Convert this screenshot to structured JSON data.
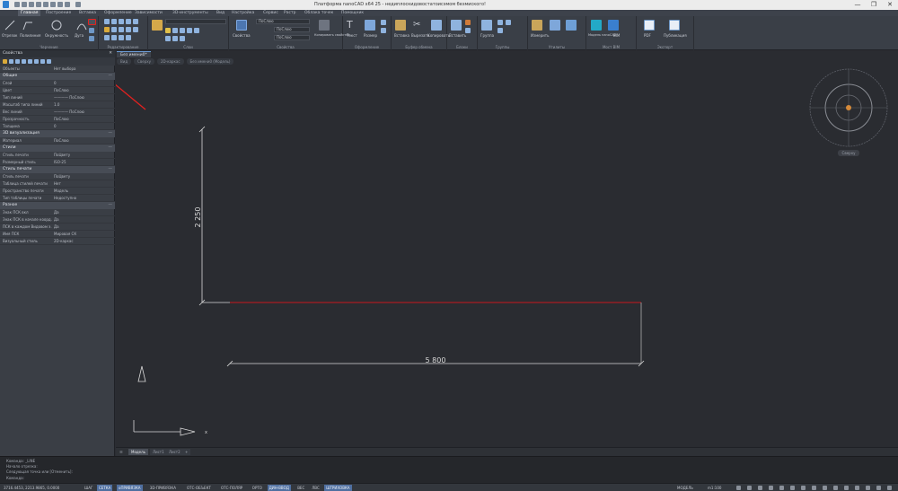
{
  "window": {
    "title": "Платформа nanoCAD x64 25 - недиплоскидовостатоисэмом безмиского!",
    "controls": [
      "—",
      "❐",
      "✕"
    ]
  },
  "menu_tabs": [
    {
      "label": "Главная",
      "active": true
    },
    {
      "label": "Построение",
      "active": false
    },
    {
      "label": "Вставка",
      "active": false
    },
    {
      "label": "Оформление",
      "active": false
    },
    {
      "label": "Зависимости",
      "active": false
    },
    {
      "label": "3D-инструменты",
      "active": false
    },
    {
      "label": "Вид",
      "active": false
    },
    {
      "label": "Настройка",
      "active": false
    },
    {
      "label": "Сервис",
      "active": false
    },
    {
      "label": "Растр",
      "active": false
    },
    {
      "label": "Облака точек",
      "active": false
    },
    {
      "label": "Помощник",
      "active": false
    }
  ],
  "ribbon": {
    "groups": [
      {
        "label": "Черчение"
      },
      {
        "label": "Редактирование"
      },
      {
        "label": "Слои"
      },
      {
        "label": "Свойства"
      },
      {
        "label": "Оформление"
      },
      {
        "label": "Буфер обмена"
      },
      {
        "label": "Блоки"
      },
      {
        "label": "Группы"
      },
      {
        "label": "Утилиты"
      },
      {
        "label": "Мост BIM"
      },
      {
        "label": "Экспорт"
      }
    ],
    "draw_tools": [
      "Отрезок",
      "Полилиния",
      "Окружность",
      "Дуга"
    ],
    "props_dropdowns": [
      "ПоСлою",
      "ПоСлою",
      "ПоСлою"
    ],
    "props_tools": [
      "Свойства",
      "Копировать свойства"
    ],
    "annot_tools": [
      "Текст",
      "Размер"
    ],
    "clipboard_tools": [
      "Вставка",
      "Вырезать",
      "Копировать"
    ],
    "block_tools": [
      "Вставить",
      "Создать блок"
    ],
    "group_tools": [
      "Группа"
    ],
    "util_tools": [
      "Измерить"
    ],
    "bim_tools": [
      "Модель nanoCAD",
      "BIM"
    ],
    "export_tools": [
      "PDF",
      "Публикация"
    ]
  },
  "properties": {
    "title": "Свойства",
    "selection": "Нет выбора",
    "objects_label": "Объекты",
    "sections": [
      {
        "name": "Общие",
        "rows": [
          {
            "k": "Слой",
            "v": "0"
          },
          {
            "k": "Цвет",
            "v": "ПоСлою"
          },
          {
            "k": "Тип линий",
            "v": "———— ПоСлою"
          },
          {
            "k": "Масштаб типа линий",
            "v": "1.0"
          },
          {
            "k": "Вес линий",
            "v": "———— ПоСлою"
          },
          {
            "k": "Прозрачность",
            "v": "ПоСлою"
          },
          {
            "k": "Толщина",
            "v": "0"
          }
        ]
      },
      {
        "name": "3D визуализация",
        "rows": [
          {
            "k": "Материал",
            "v": "ПоСлою"
          }
        ]
      },
      {
        "name": "Стили",
        "rows": [
          {
            "k": "Стиль печати",
            "v": "ПоЦвету"
          },
          {
            "k": "Размерный стиль",
            "v": "ISO-25"
          }
        ]
      },
      {
        "name": "Стиль печати",
        "rows": [
          {
            "k": "Стиль печати",
            "v": "ПоЦвету"
          },
          {
            "k": "Таблица стилей печати",
            "v": "Нет"
          },
          {
            "k": "Пространство печати",
            "v": "Модель"
          },
          {
            "k": "Тип таблицы печати",
            "v": "Недоступно"
          }
        ]
      },
      {
        "name": "Разное",
        "rows": [
          {
            "k": "Знак ПСК вкл",
            "v": "Да"
          },
          {
            "k": "Знак ПСК в начале коорд.",
            "v": "Да"
          },
          {
            "k": "ПСК в каждом Видовом э.",
            "v": "Да"
          },
          {
            "k": "Имя ПСК",
            "v": "Мировая СК"
          },
          {
            "k": "Визуальный стиль",
            "v": "2D-каркас"
          }
        ]
      }
    ]
  },
  "document": {
    "tab": "Без имени0*",
    "breadcrumb": [
      "Вид",
      "Сверху",
      "2D-каркас",
      "Без имени0 (Модель)"
    ]
  },
  "drawing": {
    "dim_horizontal": "5 800",
    "dim_vertical": "2 250",
    "line_color": "#c8161d",
    "dim_color": "#d9d9d9",
    "viewcube_label": "Сверху"
  },
  "layout_tabs": [
    {
      "label": "Модель",
      "active": true
    },
    {
      "label": "Лист1",
      "active": false
    },
    {
      "label": "Лист2",
      "active": false
    }
  ],
  "command_line": [
    "Команда: _LINE",
    "Начало отрезка:",
    "Следующая точка или [Отменить]:",
    "Команда:"
  ],
  "status_bar": {
    "coords": "3716.4453, 2213.9865, 0.0000",
    "toggles": [
      {
        "label": "ШАГ",
        "on": false
      },
      {
        "label": "СЕТКА",
        "on": true
      },
      {
        "label": "оПРИВЯЗКА",
        "on": true
      },
      {
        "label": "3D-ПРИВЯЗКА",
        "on": false
      },
      {
        "label": "ОТС-ОБЪЕКТ",
        "on": false
      },
      {
        "label": "ОТС-ПОЛЯР",
        "on": false
      },
      {
        "label": "ОРТО",
        "on": false
      },
      {
        "label": "ДИН-ВВОД",
        "on": true
      },
      {
        "label": "ВЕС",
        "on": false
      },
      {
        "label": "ЛВС",
        "on": false
      },
      {
        "label": "ШТРИХОВКА",
        "on": true
      }
    ],
    "model": "МОДЕЛЬ",
    "scale": "m1:100"
  },
  "accent": "#e4211f"
}
